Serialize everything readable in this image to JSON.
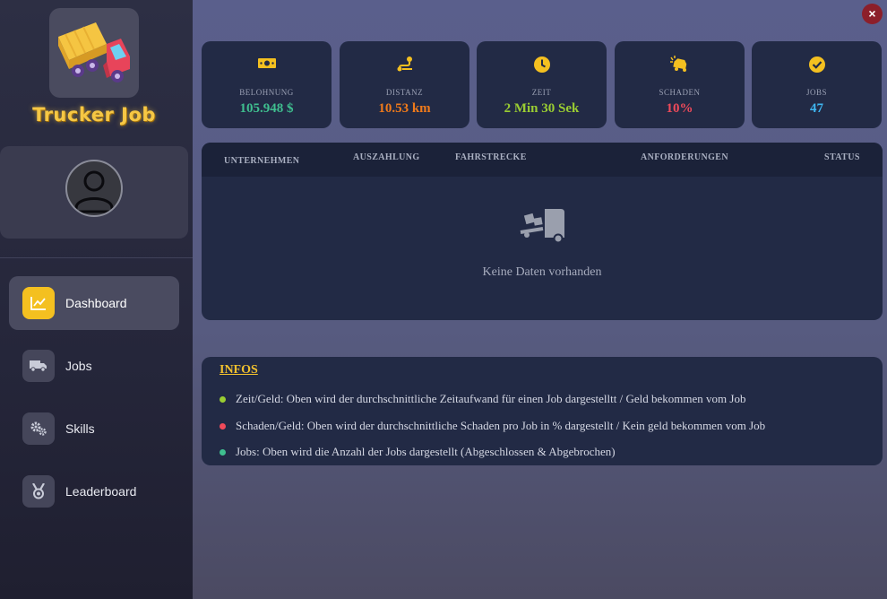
{
  "sidebar": {
    "brand": "Trucker Job",
    "nav": [
      {
        "label": "Dashboard",
        "icon": "chart-line-icon",
        "active": true
      },
      {
        "label": "Jobs",
        "icon": "truck-icon"
      },
      {
        "label": "Skills",
        "icon": "gears-icon"
      },
      {
        "label": "Leaderboard",
        "icon": "medal-icon"
      }
    ]
  },
  "stats": [
    {
      "label": "BELOHNUNG",
      "value": "105.948 $",
      "color": "#3fbf8f",
      "icon": "money-icon"
    },
    {
      "label": "DISTANZ",
      "value": "10.53 km",
      "color": "#f07a1a",
      "icon": "route-icon"
    },
    {
      "label": "ZEIT",
      "value": "2 Min 30 Sek",
      "color": "#9acd32",
      "icon": "clock-icon"
    },
    {
      "label": "SCHADEN",
      "value": "10%",
      "color": "#f04a5a",
      "icon": "car-crash-icon"
    },
    {
      "label": "JOBS",
      "value": "47",
      "color": "#3fb6f0",
      "icon": "check-circle-icon"
    }
  ],
  "table": {
    "columns": [
      "UNTERNEHMEN",
      "AUSZAHLUNG",
      "FAHRSTRECKE",
      "ANFORDERUNGEN",
      "STATUS"
    ],
    "empty_text": "Keine Daten vorhanden"
  },
  "infos": {
    "title": "INFOS",
    "items": [
      {
        "text": "Zeit/Geld: Oben wird der durchschnittliche Zeitaufwand für einen Job dargestelltt / Geld bekommen vom Job",
        "color": "#9acd32"
      },
      {
        "text": "Schaden/Geld: Oben wird der durchschnittliche Schaden pro Job in % dargestellt / Kein geld bekommen vom Job",
        "color": "#f04a5a"
      },
      {
        "text": "Jobs: Oben wird die Anzahl der Jobs dargestellt (Abgeschlossen & Abgebrochen)",
        "color": "#3fbf8f"
      }
    ]
  },
  "close_label": "×"
}
